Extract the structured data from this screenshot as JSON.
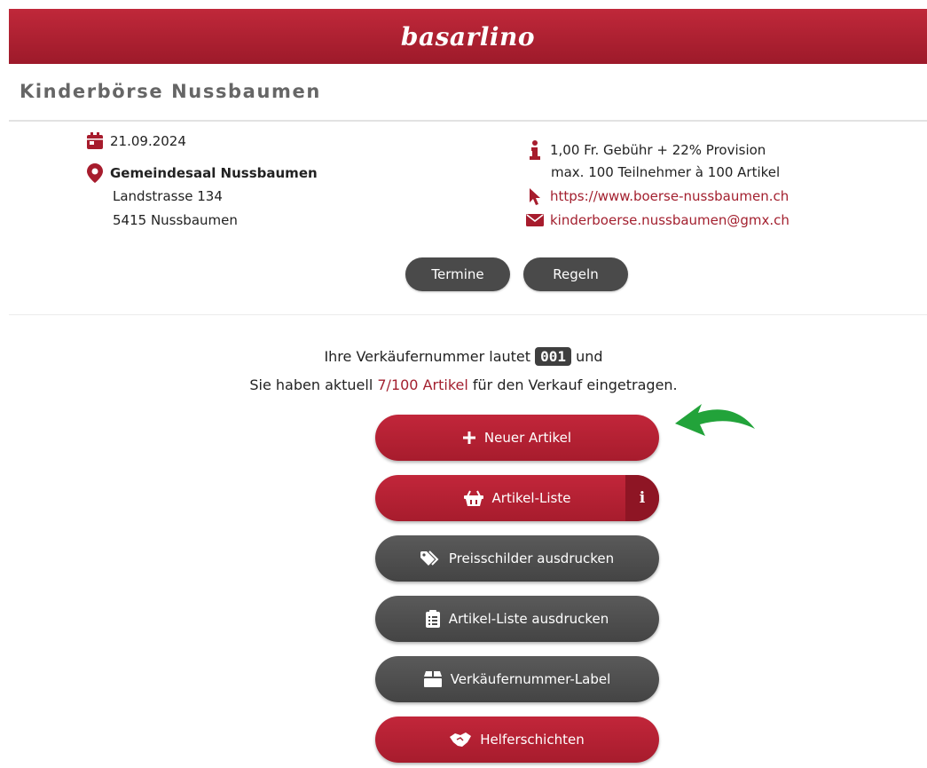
{
  "header": {
    "logo": "basarlino"
  },
  "event": {
    "title": "Kinderbörse Nussbaumen",
    "date": "21.09.2024",
    "venue_name": "Gemeindesaal Nussbaumen",
    "street": "Landstrasse 134",
    "city": "5415 Nussbaumen",
    "fee": "1,00 Fr. Gebühr + 22% Provision",
    "limits": "max. 100 Teilnehmer à 100 Artikel",
    "website": "https://www.boerse-nussbaumen.ch",
    "email": "kinderboerse.nussbaumen@gmx.ch"
  },
  "pills": {
    "termine": "Termine",
    "regeln": "Regeln"
  },
  "seller": {
    "line1_prefix": "Ihre Verkäufernummer lautet",
    "number": "001",
    "line1_suffix": "und",
    "line2_prefix": "Sie haben aktuell",
    "articles": "7/100 Artikel",
    "line2_suffix": "für den Verkauf eingetragen."
  },
  "actions": {
    "new_article": "Neuer Artikel",
    "article_list": "Artikel-Liste",
    "article_list_info": "i",
    "print_tags": "Preisschilder ausdrucken",
    "print_list": "Artikel-Liste ausdrucken",
    "seller_label": "Verkäufernummer-Label",
    "helper_shifts": "Helferschichten"
  },
  "colors": {
    "brand_red": "#a71c2d",
    "dark_gray": "#4a4a4a",
    "arrow_green": "#22a33a"
  },
  "icons": [
    "calendar-icon",
    "map-pin-icon",
    "info-icon",
    "cursor-icon",
    "envelope-icon",
    "plus-icon",
    "basket-icon",
    "tags-icon",
    "clipboard-icon",
    "box-icon",
    "handshake-icon",
    "green-arrow-icon"
  ]
}
